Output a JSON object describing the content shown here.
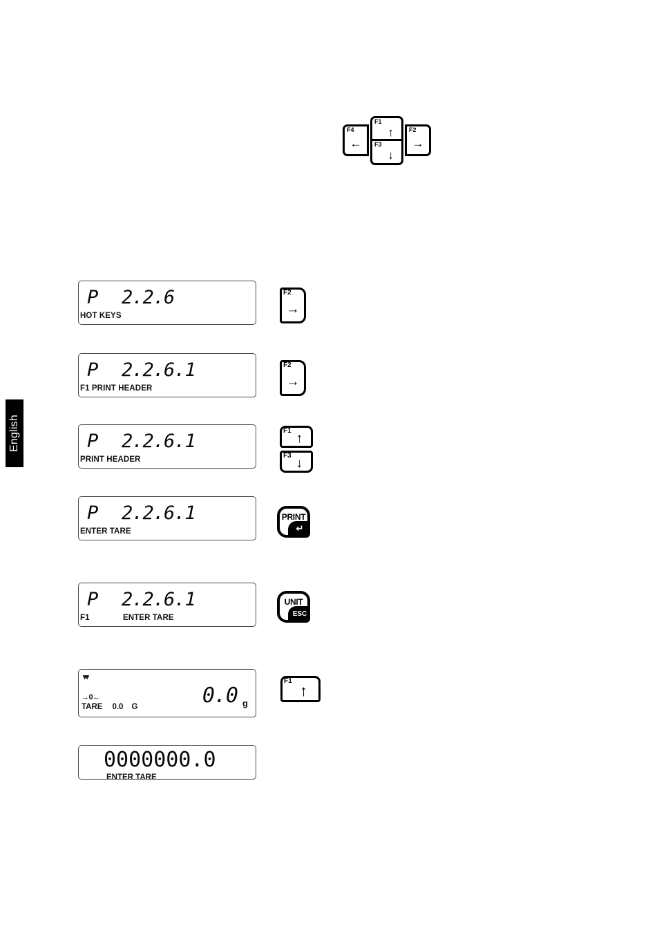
{
  "page": {
    "language_tab": "English"
  },
  "nav_cluster": {
    "name": "navigation-key-cluster",
    "keys": [
      {
        "fn": "F1",
        "arrow": "↑",
        "icon": "arrow-up-icon"
      },
      {
        "fn": "F3",
        "arrow": "↓",
        "icon": "arrow-down-icon"
      },
      {
        "fn": "F4",
        "arrow": "←",
        "icon": "arrow-left-icon"
      },
      {
        "fn": "F2",
        "arrow": "→",
        "icon": "arrow-right-icon"
      }
    ]
  },
  "steps": [
    {
      "display": {
        "type": "menu",
        "prefix": "P",
        "code": "2.2.6",
        "sub_left": "HOT KEYS",
        "sub_mid": ""
      },
      "key": {
        "style": "fn-tall",
        "label": "F2",
        "arrow": "→",
        "icon": "arrow-right-icon"
      }
    },
    {
      "display": {
        "type": "menu",
        "prefix": "P",
        "code": "2.2.6.1",
        "sub_left": "F1 PRINT HEADER",
        "sub_mid": ""
      },
      "key": {
        "style": "fn-tall",
        "label": "F2",
        "arrow": "→",
        "icon": "arrow-right-icon"
      }
    },
    {
      "display": {
        "type": "menu",
        "prefix": "P",
        "code": "2.2.6.1",
        "sub_left": "PRINT HEADER",
        "sub_mid": ""
      },
      "key_pair": [
        {
          "style": "fn-wide",
          "label": "F1",
          "arrow": "↑",
          "icon": "arrow-up-icon"
        },
        {
          "style": "fn-wide-lower",
          "label": "F3",
          "arrow": "↓",
          "icon": "arrow-down-icon"
        }
      ]
    },
    {
      "display": {
        "type": "menu",
        "prefix": "P",
        "code": "2.2.6.1",
        "sub_left": "ENTER TARE",
        "sub_mid": ""
      },
      "key": {
        "style": "action",
        "label": "PRINT",
        "corner": "↵",
        "icon": "print-enter-key-icon"
      }
    },
    {
      "display": {
        "type": "menu",
        "prefix": "P",
        "code": "2.2.6.1",
        "sub_left": "F1",
        "sub_mid": "ENTER TARE"
      },
      "key": {
        "style": "action",
        "label": "UNIT",
        "corner": "ESC",
        "icon": "unit-esc-key-icon"
      }
    },
    {
      "display": {
        "type": "weighing",
        "stable_mark": "▾▾",
        "zero_mark": "→0←",
        "tare_label": "TARE",
        "tare_value": "0.0",
        "tare_unit": "G",
        "value": "0.0",
        "unit": "g"
      },
      "key": {
        "style": "fn-big",
        "label": "F1",
        "arrow": "↑",
        "icon": "arrow-up-icon"
      }
    },
    {
      "display": {
        "type": "tare-entry",
        "digits": "0000000.0",
        "sub": "ENTER TARE"
      }
    }
  ]
}
